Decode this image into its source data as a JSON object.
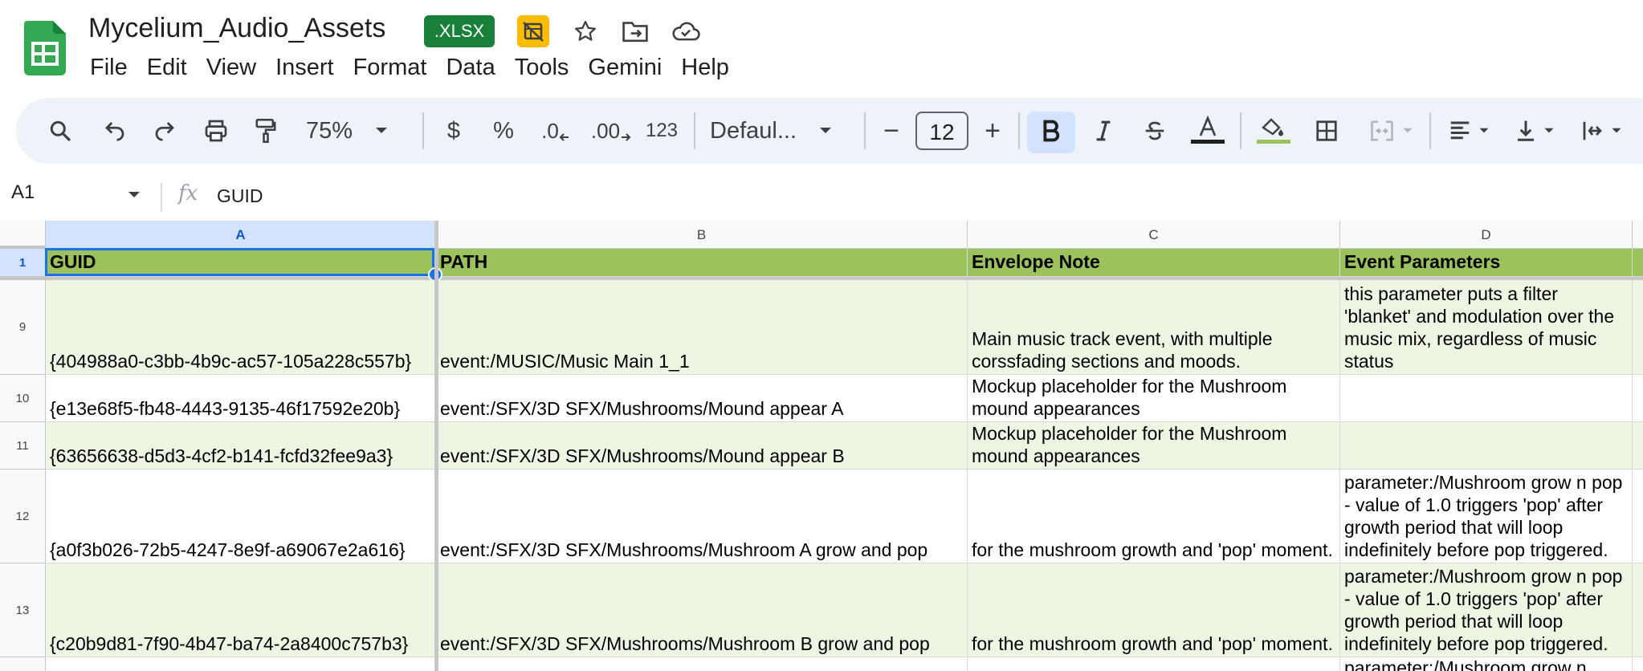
{
  "app": {
    "title": "Mycelium_Audio_Assets",
    "file_badge": ".XLSX",
    "icons": [
      "sheets-logo-icon",
      "offline-sync-off-icon",
      "star-icon",
      "move-to-folder-icon",
      "cloud-saved-icon"
    ]
  },
  "menu": [
    "File",
    "Edit",
    "View",
    "Insert",
    "Format",
    "Data",
    "Tools",
    "Gemini",
    "Help"
  ],
  "toolbar": {
    "zoom": "75%",
    "currency": "$",
    "percent": "%",
    "decrease_decimal": ".0",
    "increase_decimal": ".00",
    "number_format": "123",
    "font": "Defaul...",
    "font_size": "12",
    "minus": "−",
    "plus": "+"
  },
  "formula_bar": {
    "cell_ref": "A1",
    "fx": "fx",
    "content": "GUID"
  },
  "columns": [
    "A",
    "B",
    "C",
    "D"
  ],
  "header_row": {
    "row_number": "1",
    "cells": [
      "GUID",
      "PATH",
      "Envelope Note",
      "Event Parameters"
    ]
  },
  "rows": [
    {
      "row_number": "9",
      "cells": [
        "{404988a0-c3bb-4b9c-ac57-105a228c557b}",
        "event:/MUSIC/Music Main 1_1",
        "Main music track event, with multiple corssfading sections and moods.",
        "this parameter puts a filter 'blanket' and modulation over the music mix, regardless of music status"
      ]
    },
    {
      "row_number": "10",
      "cells": [
        "{e13e68f5-fb48-4443-9135-46f17592e20b}",
        "event:/SFX/3D SFX/Mushrooms/Mound appear A",
        "Mockup placeholder for the Mushroom mound appearances",
        ""
      ]
    },
    {
      "row_number": "11",
      "cells": [
        "{63656638-d5d3-4cf2-b141-fcfd32fee9a3}",
        "event:/SFX/3D SFX/Mushrooms/Mound appear B",
        "Mockup placeholder for the Mushroom mound appearances",
        ""
      ]
    },
    {
      "row_number": "12",
      "cells": [
        "{a0f3b026-72b5-4247-8e9f-a69067e2a616}",
        "event:/SFX/3D SFX/Mushrooms/Mushroom A grow and pop",
        "for the mushroom growth and 'pop' moment.",
        "parameter:/Mushroom grow n pop - value of 1.0 triggers 'pop' after growth period that will loop indefinitely before pop triggered."
      ]
    },
    {
      "row_number": "13",
      "cells": [
        "{c20b9d81-7f90-4b47-ba74-2a8400c757b3}",
        "event:/SFX/3D SFX/Mushrooms/Mushroom B grow and pop",
        "for the mushroom growth and 'pop' moment.",
        "parameter:/Mushroom grow n pop - value of 1.0 triggers 'pop' after growth period that will loop indefinitely before pop triggered."
      ]
    }
  ],
  "partial_next_row": {
    "cell_d": "parameter:/Mushroom grow n"
  },
  "colors": {
    "header_fill": "#9bc25c",
    "band_fill": "#eef6e3",
    "selection": "#1a73e8",
    "badge_green": "#188038",
    "toolbar_bg": "#eef2f9"
  }
}
